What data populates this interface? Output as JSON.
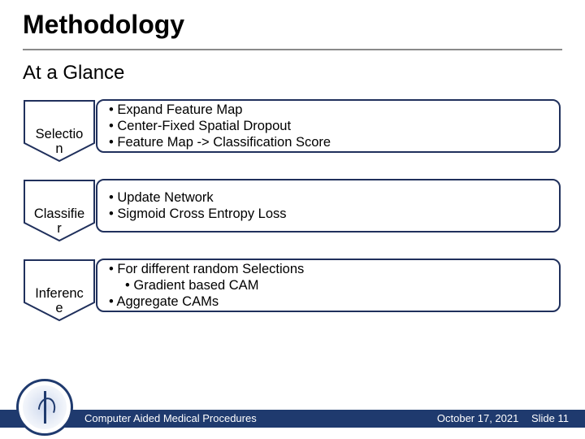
{
  "title": "Methodology",
  "subtitle": "At a Glance",
  "rows": [
    {
      "label": "Selectio\nn",
      "bullets": [
        {
          "text": "• Expand Feature Map",
          "indent": false
        },
        {
          "text": "• Center-Fixed Spatial Dropout",
          "indent": false
        },
        {
          "text": "• Feature Map -> Classification Score",
          "indent": false
        }
      ]
    },
    {
      "label": "Classifie\nr",
      "bullets": [
        {
          "text": "• Update Network",
          "indent": false
        },
        {
          "text": "• Sigmoid Cross Entropy Loss",
          "indent": false
        }
      ]
    },
    {
      "label": "Inferenc\ne",
      "bullets": [
        {
          "text": "• For different random Selections",
          "indent": false
        },
        {
          "text": "• Gradient based CAM",
          "indent": true
        },
        {
          "text": "• Aggregate CAMs",
          "indent": false
        }
      ]
    }
  ],
  "footer": {
    "left": "Computer Aided Medical Procedures",
    "date": "October 17, 2021",
    "slide": "Slide 11"
  },
  "colors": {
    "accent": "#1f3a6e",
    "border": "#20305c"
  }
}
